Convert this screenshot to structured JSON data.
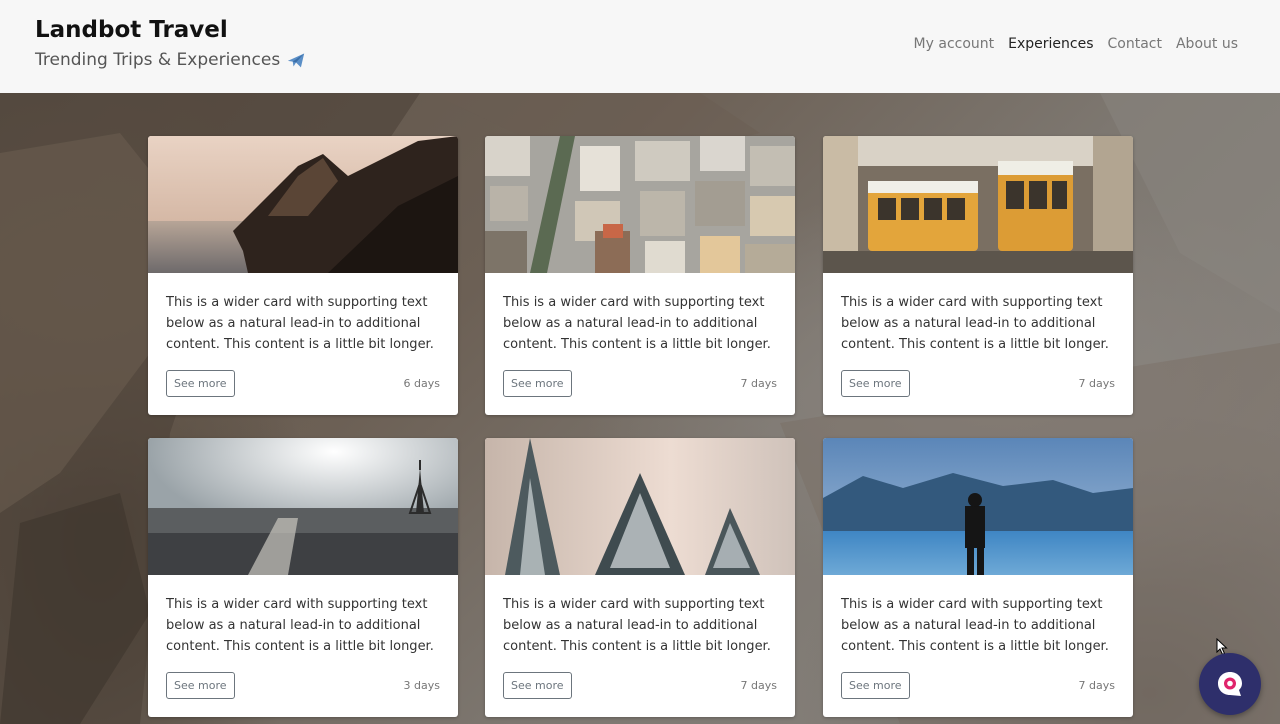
{
  "header": {
    "title": "Landbot Travel",
    "subtitle": "Trending Trips & Experiences",
    "subtitle_icon": "airplane-icon",
    "nav": [
      {
        "label": "My account"
      },
      {
        "label": "Experiences",
        "active": true
      },
      {
        "label": "Contact"
      },
      {
        "label": "About us"
      }
    ]
  },
  "cards": [
    {
      "image": "coastal-cliff-sunset",
      "text": "This is a wider card with supporting text below as a natural lead-in to additional content. This content is a little bit longer.",
      "button": "See more",
      "days": "6 days"
    },
    {
      "image": "city-rooftops-aerial",
      "text": "This is a wider card with supporting text below as a natural lead-in to additional content. This content is a little bit longer.",
      "button": "See more",
      "days": "7 days"
    },
    {
      "image": "yellow-trams",
      "text": "This is a wider card with supporting text below as a natural lead-in to additional content. This content is a little bit longer.",
      "button": "See more",
      "days": "7 days"
    },
    {
      "image": "paris-eiffel-skyline",
      "text": "This is a wider card with supporting text below as a natural lead-in to additional content. This content is a little bit longer.",
      "button": "See more",
      "days": "3 days"
    },
    {
      "image": "snowy-pine-forest",
      "text": "This is a wider card with supporting text below as a natural lead-in to additional content. This content is a little bit longer.",
      "button": "See more",
      "days": "7 days"
    },
    {
      "image": "lake-mountains-person",
      "text": "This is a wider card with supporting text below as a natural lead-in to additional content. This content is a little bit longer.",
      "button": "See more",
      "days": "7 days"
    }
  ],
  "chat": {
    "icon": "chat-bubble-icon",
    "accent": "#2e2f6b",
    "badge_color": "#e0246b"
  }
}
